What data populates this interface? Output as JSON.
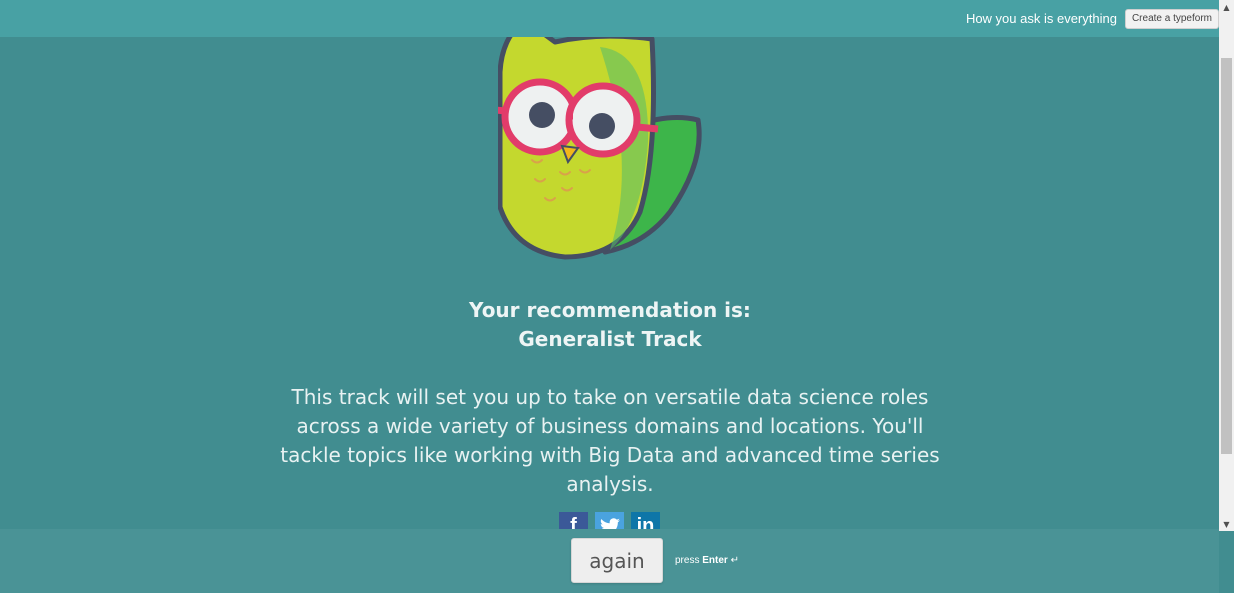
{
  "topbar": {
    "tagline": "How you ask is everything",
    "create_label": "Create a typeform"
  },
  "result": {
    "heading_line1": "Your recommendation is:",
    "heading_line2": "Generalist Track",
    "description": "This track will set you up to take on versatile data science roles across a wide variety of business domains and locations. You'll tackle topics like working with Big Data and advanced time series analysis."
  },
  "share": {
    "facebook_glyph": "f",
    "twitter_glyph": "t",
    "linkedin_glyph": "in"
  },
  "footer": {
    "again_label": "again",
    "press_label": "press",
    "enter_label": "Enter",
    "enter_icon": "↵"
  },
  "colors": {
    "background": "#418d90",
    "topbar": "#48a1a4",
    "footer": "#4a9396",
    "owl_body": "#c4d82e",
    "owl_wing": "#3db54a",
    "glasses": "#e23c6a",
    "outline": "#454e63"
  }
}
